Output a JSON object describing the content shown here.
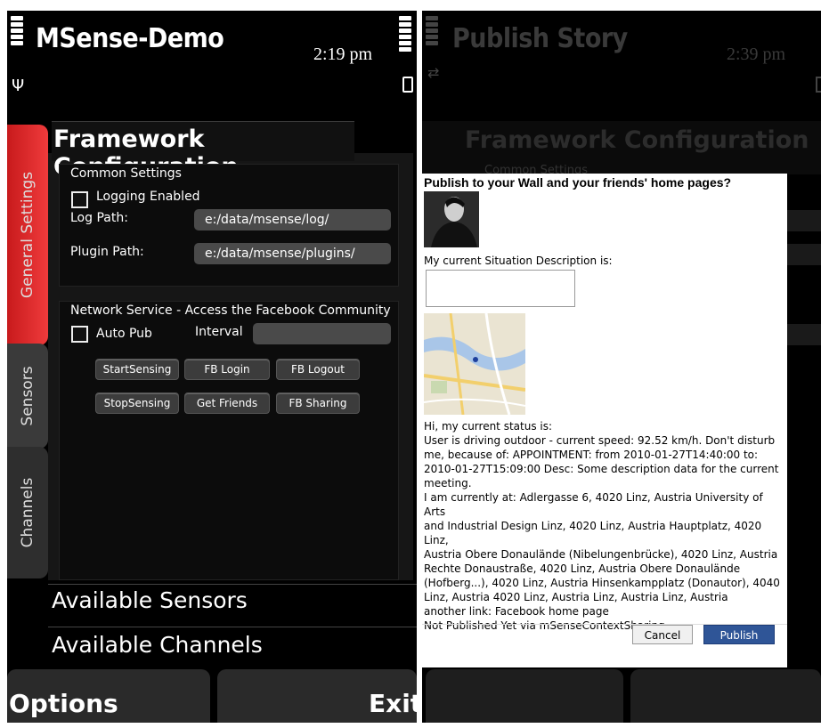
{
  "left": {
    "app_title": "MSense-Demo",
    "time": "2:19 pm",
    "tabs": [
      "General Settings",
      "Sensors",
      "Channels"
    ],
    "panel_title": "Framework Configuration",
    "common_settings": {
      "heading": "Common Settings",
      "logging_label": "Logging Enabled",
      "log_path_label": "Log Path:",
      "log_path_value": "e:/data/msense/log/",
      "plugin_path_label": "Plugin Path:",
      "plugin_path_value": "e:/data/msense/plugins/"
    },
    "network": {
      "heading": "Network Service - Access the Facebook Community",
      "auto_pub_label": "Auto Pub",
      "interval_label": "Interval",
      "interval_value": "",
      "buttons": [
        "StartSensing",
        "FB Login",
        "FB Logout",
        "StopSensing",
        "Get Friends",
        "FB Sharing"
      ]
    },
    "sections": [
      "Available Sensors",
      "Available Channels"
    ],
    "softkeys": {
      "left": "Options",
      "right": "Exit"
    }
  },
  "right": {
    "app_title": "Publish Story",
    "time": "2:39 pm",
    "bg_panel_title": "Framework Configuration",
    "bg_heading": "Common Settings",
    "dialog": {
      "title": "Publish to your Wall and your friends' home pages?",
      "description_label": "My current Situation Description is:",
      "description_value": "",
      "status_lines": [
        "Hi, my current status is:",
        "User is driving outdoor - current speed: 92.52 km/h. Don't disturb",
        "me, because of: APPOINTMENT: from 2010-01-27T14:40:00 to:",
        "2010-01-27T15:09:00 Desc: Some description data for the current",
        "meeting.",
        "I am currently at: Adlergasse 6, 4020 Linz, Austria University of Arts",
        "and Industrial Design Linz, 4020 Linz, Austria Hauptplatz, 4020 Linz,",
        "Austria Obere Donaulände (Nibelungenbrücke), 4020 Linz, Austria",
        "Rechte Donaustraße, 4020 Linz, Austria Obere Donaulände",
        "(Hofberg...), 4020 Linz, Austria Hinsenkampplatz (Donautor), 4040",
        "Linz, Austria 4020 Linz, Austria Linz, Austria Linz, Austria",
        "another link: Facebook home page",
        "Not Published Yet via mSenseContextSharing"
      ],
      "cancel_label": "Cancel",
      "publish_label": "Publish"
    }
  },
  "colors": {
    "active_tab": "#e0282a",
    "publish_button": "#2f5597"
  }
}
